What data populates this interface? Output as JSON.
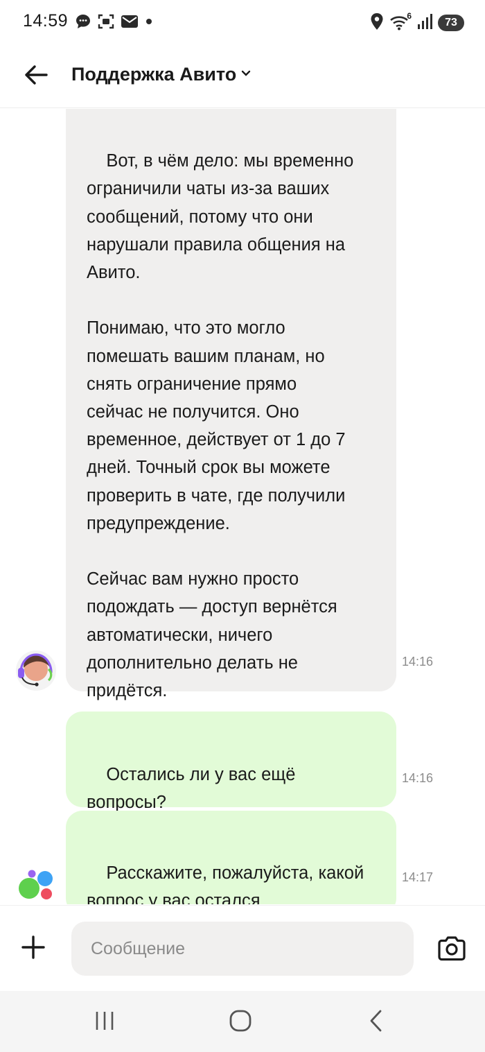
{
  "status_bar": {
    "time": "14:59",
    "left_icons": [
      "messages-icon",
      "screenshot-icon",
      "mail-icon",
      "dot-icon"
    ],
    "right_icons": [
      "location-icon",
      "wifi-icon",
      "signal-icon"
    ],
    "wifi_badge": "6",
    "battery": "73"
  },
  "header": {
    "title": "Поддержка Авито",
    "back_icon": "arrow-left-icon",
    "dropdown_icon": "chevron-down-icon"
  },
  "messages": [
    {
      "side": "incoming",
      "text": "Вот, в чём дело: мы временно\nограничили чаты из-за ваших\nсообщений, потому что они\nнарушали правила общения на\nАвито.\n\nПонимаю, что это могло\nпомешать вашим планам, но\nснять ограничение прямо\nсейчас не получится. Оно\nвременное, действует от 1 до 7\nдней. Точный срок вы можете\nпроверить в чате, где получили\nпредупреждение.\n\nСейчас вам нужно просто\nподождать — доступ вернётся\nавтоматически, ничего\nдополнительно делать не\nпридётся.",
      "time": "14:16",
      "avatar": "support-agent-avatar"
    },
    {
      "side": "outgoing",
      "text": "Остались ли у вас ещё\nвопросы?",
      "time": "14:16"
    },
    {
      "side": "outgoing",
      "text": "Расскажите, пожалуйста, какой\nвопрос у вас остался",
      "time": "14:17",
      "avatar": "avito-logo-avatar"
    }
  ],
  "composer": {
    "placeholder": "Сообщение",
    "value": "",
    "add_icon": "plus-icon",
    "camera_icon": "camera-icon"
  },
  "nav_bar": {
    "icons": [
      "recent-apps-icon",
      "home-icon",
      "back-icon"
    ]
  },
  "colors": {
    "incoming_bubble": "#f0efee",
    "outgoing_bubble": "#e2fbd7",
    "input_background": "#f1f0ef",
    "timestamp": "#8c8c8c"
  }
}
